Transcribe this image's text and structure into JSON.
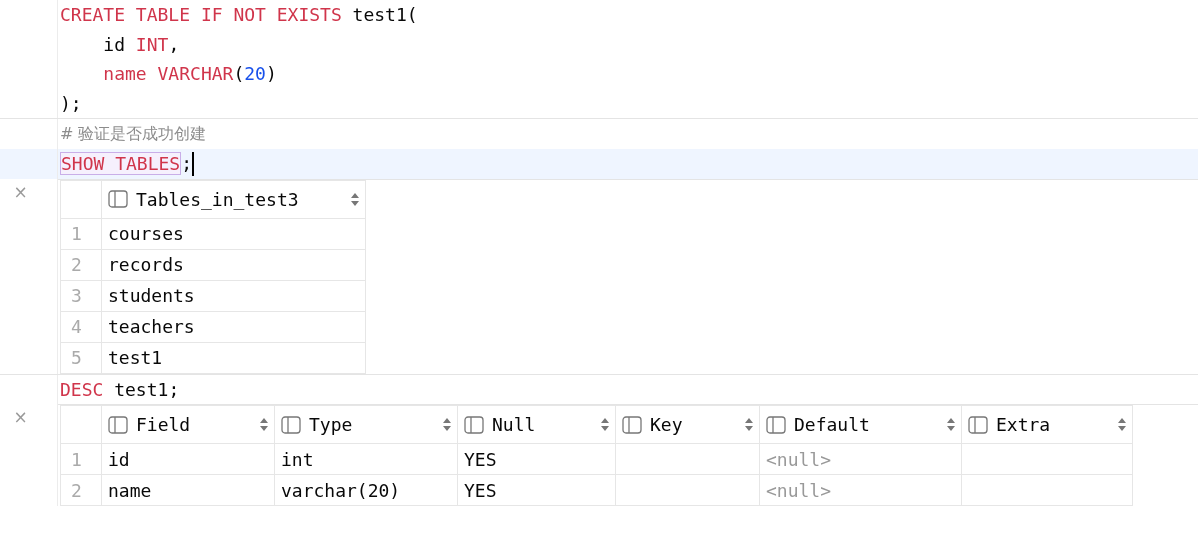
{
  "blocks": [
    {
      "kind": "code",
      "lines": [
        {
          "current": false,
          "caret": false,
          "tokens": [
            {
              "kind": "keyword",
              "text": "CREATE TABLE IF NOT EXISTS"
            },
            {
              "kind": "plain",
              "text": " test1("
            }
          ]
        },
        {
          "current": false,
          "caret": false,
          "indented": true,
          "tokens": [
            {
              "kind": "plain",
              "text": "id "
            },
            {
              "kind": "keyword",
              "text": "INT"
            },
            {
              "kind": "plain",
              "text": ","
            }
          ]
        },
        {
          "current": false,
          "caret": false,
          "indented": true,
          "tokens": [
            {
              "kind": "keyword",
              "text": "name VARCHAR"
            },
            {
              "kind": "plain",
              "text": "("
            },
            {
              "kind": "number",
              "text": "20"
            },
            {
              "kind": "plain",
              "text": ")"
            }
          ]
        },
        {
          "current": false,
          "caret": false,
          "tokens": [
            {
              "kind": "plain",
              "text": ");"
            }
          ]
        }
      ]
    },
    {
      "kind": "code",
      "lines": [
        {
          "current": false,
          "caret": false,
          "tokens": [
            {
              "kind": "comment",
              "text": "# 验证是否成功创建"
            }
          ]
        },
        {
          "current": true,
          "caret": true,
          "tokens": [
            {
              "kind": "keyword_boxed",
              "text": "SHOW TABLES"
            },
            {
              "kind": "plain",
              "text": ";"
            }
          ]
        }
      ]
    },
    {
      "kind": "result",
      "close": "×",
      "columns": [
        "Tables_in_test3"
      ],
      "rows": [
        {
          "number": "1",
          "cells": [
            {
              "kind": "value",
              "text": "courses"
            }
          ]
        },
        {
          "number": "2",
          "cells": [
            {
              "kind": "value",
              "text": "records"
            }
          ]
        },
        {
          "number": "3",
          "cells": [
            {
              "kind": "value",
              "text": "students"
            }
          ]
        },
        {
          "number": "4",
          "cells": [
            {
              "kind": "value",
              "text": "teachers"
            }
          ]
        },
        {
          "number": "5",
          "cells": [
            {
              "kind": "value",
              "text": "test1"
            }
          ]
        }
      ]
    },
    {
      "kind": "code",
      "lines": [
        {
          "current": false,
          "caret": false,
          "tokens": [
            {
              "kind": "keyword",
              "text": "DESC"
            },
            {
              "kind": "plain",
              "text": " test1;"
            }
          ]
        }
      ]
    },
    {
      "kind": "result",
      "close": "×",
      "columns": [
        "Field",
        "Type",
        "Null",
        "Key",
        "Default",
        "Extra"
      ],
      "rows": [
        {
          "number": "1",
          "cells": [
            {
              "kind": "value",
              "text": "id"
            },
            {
              "kind": "value",
              "text": "int"
            },
            {
              "kind": "value",
              "text": "YES"
            },
            {
              "kind": "empty"
            },
            {
              "kind": "null",
              "text": "<null>"
            },
            {
              "kind": "empty"
            }
          ]
        },
        {
          "number": "2",
          "cells": [
            {
              "kind": "value",
              "text": "name"
            },
            {
              "kind": "value",
              "text": "varchar(20)"
            },
            {
              "kind": "value",
              "text": "YES"
            },
            {
              "kind": "empty"
            },
            {
              "kind": "null",
              "text": "<null>"
            },
            {
              "kind": "empty"
            }
          ]
        }
      ]
    }
  ]
}
